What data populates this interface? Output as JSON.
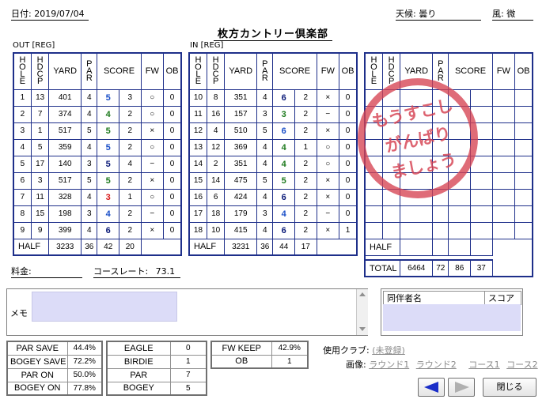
{
  "header": {
    "date_label": "日付:",
    "date_value": "2019/07/04",
    "weather_label": "天候:",
    "weather_value": "曇り",
    "wind_label": "風:",
    "wind_value": "微",
    "course_name": "枚方カントリー倶楽部"
  },
  "columns": {
    "hole": "HOLE",
    "hdcp": "HDCP",
    "yard": "YARD",
    "par": "PAR",
    "score": "SCORE",
    "fw": "FW",
    "ob": "OB"
  },
  "out": {
    "label": "OUT [REG]",
    "rows": [
      {
        "hole": "1",
        "hdcp": "13",
        "yard": "401",
        "par": "4",
        "score": "5",
        "putt": "3",
        "fw": "○",
        "ob": "0",
        "sc": "bogey-blue"
      },
      {
        "hole": "2",
        "hdcp": "7",
        "yard": "374",
        "par": "4",
        "score": "4",
        "putt": "2",
        "fw": "○",
        "ob": "0",
        "sc": "par"
      },
      {
        "hole": "3",
        "hdcp": "1",
        "yard": "517",
        "par": "5",
        "score": "5",
        "putt": "2",
        "fw": "×",
        "ob": "0",
        "sc": "par"
      },
      {
        "hole": "4",
        "hdcp": "5",
        "yard": "359",
        "par": "4",
        "score": "5",
        "putt": "2",
        "fw": "○",
        "ob": "0",
        "sc": "bogey-blue"
      },
      {
        "hole": "5",
        "hdcp": "17",
        "yard": "140",
        "par": "3",
        "score": "5",
        "putt": "4",
        "fw": "−",
        "ob": "0",
        "sc": "double"
      },
      {
        "hole": "6",
        "hdcp": "3",
        "yard": "517",
        "par": "5",
        "score": "5",
        "putt": "2",
        "fw": "×",
        "ob": "0",
        "sc": "par"
      },
      {
        "hole": "7",
        "hdcp": "11",
        "yard": "328",
        "par": "4",
        "score": "3",
        "putt": "1",
        "fw": "○",
        "ob": "0",
        "sc": "birdie"
      },
      {
        "hole": "8",
        "hdcp": "15",
        "yard": "198",
        "par": "3",
        "score": "4",
        "putt": "2",
        "fw": "−",
        "ob": "0",
        "sc": "bogey-blue"
      },
      {
        "hole": "9",
        "hdcp": "9",
        "yard": "399",
        "par": "4",
        "score": "6",
        "putt": "2",
        "fw": "×",
        "ob": "0",
        "sc": "double"
      }
    ],
    "half_label": "HALF",
    "half_yard": "3233",
    "half_par": "36",
    "half_score": "42",
    "half_putt": "20"
  },
  "in": {
    "label": "IN [REG]",
    "rows": [
      {
        "hole": "10",
        "hdcp": "8",
        "yard": "351",
        "par": "4",
        "score": "6",
        "putt": "2",
        "fw": "×",
        "ob": "0",
        "sc": "double"
      },
      {
        "hole": "11",
        "hdcp": "16",
        "yard": "157",
        "par": "3",
        "score": "3",
        "putt": "2",
        "fw": "−",
        "ob": "0",
        "sc": "par"
      },
      {
        "hole": "12",
        "hdcp": "4",
        "yard": "510",
        "par": "5",
        "score": "6",
        "putt": "2",
        "fw": "×",
        "ob": "0",
        "sc": "bogey-blue"
      },
      {
        "hole": "13",
        "hdcp": "12",
        "yard": "369",
        "par": "4",
        "score": "4",
        "putt": "1",
        "fw": "○",
        "ob": "0",
        "sc": "par"
      },
      {
        "hole": "14",
        "hdcp": "2",
        "yard": "351",
        "par": "4",
        "score": "4",
        "putt": "2",
        "fw": "○",
        "ob": "0",
        "sc": "par"
      },
      {
        "hole": "15",
        "hdcp": "14",
        "yard": "475",
        "par": "5",
        "score": "5",
        "putt": "2",
        "fw": "×",
        "ob": "0",
        "sc": "par"
      },
      {
        "hole": "16",
        "hdcp": "6",
        "yard": "424",
        "par": "4",
        "score": "6",
        "putt": "2",
        "fw": "×",
        "ob": "0",
        "sc": "double"
      },
      {
        "hole": "17",
        "hdcp": "18",
        "yard": "179",
        "par": "3",
        "score": "4",
        "putt": "2",
        "fw": "−",
        "ob": "0",
        "sc": "bogey-blue"
      },
      {
        "hole": "18",
        "hdcp": "10",
        "yard": "415",
        "par": "4",
        "score": "6",
        "putt": "2",
        "fw": "×",
        "ob": "1",
        "sc": "double"
      }
    ],
    "half_label": "HALF",
    "half_yard": "3231",
    "half_par": "36",
    "half_score": "44",
    "half_putt": "17"
  },
  "third": {
    "half_label": "HALF",
    "total_label": "TOTAL",
    "total_yard": "6464",
    "total_par": "72",
    "total_score": "86",
    "total_putt": "37"
  },
  "stamp": {
    "line1": "もうすこし",
    "line2": "がんばり",
    "line3": "ましょう"
  },
  "fee": {
    "label": "料金:",
    "value": ""
  },
  "course_rate": {
    "label": "コースレート:",
    "value": "73.1"
  },
  "memo": {
    "label": "メモ",
    "value": ""
  },
  "companions": {
    "col_name": "同伴者名",
    "col_score": "スコア"
  },
  "stats1": [
    {
      "label": "PAR SAVE",
      "value": "44.4%"
    },
    {
      "label": "BOGEY SAVE",
      "value": "72.2%"
    },
    {
      "label": "PAR ON",
      "value": "50.0%"
    },
    {
      "label": "BOGEY ON",
      "value": "77.8%"
    }
  ],
  "stats2": [
    {
      "label": "EAGLE",
      "value": "0"
    },
    {
      "label": "BIRDIE",
      "value": "1"
    },
    {
      "label": "PAR",
      "value": "7"
    },
    {
      "label": "BOGEY",
      "value": "5"
    }
  ],
  "stats3": [
    {
      "label": "FW KEEP",
      "value": "42.9%"
    },
    {
      "label": "OB",
      "value": "1"
    }
  ],
  "clubs": {
    "label": "使用クラブ:",
    "link": "(未登録)"
  },
  "images": {
    "label": "画像:",
    "links": [
      "ラウンド1",
      "ラウンド2",
      "コース1",
      "コース2"
    ]
  },
  "buttons": {
    "close": "閉じる"
  },
  "colors": {
    "table_border": "#1e2f8a",
    "score_blue": "#1a4fc8",
    "score_navy": "#0a1a78",
    "score_green": "#1e7a1e",
    "score_red": "#d81818",
    "stamp": "#d64252"
  }
}
